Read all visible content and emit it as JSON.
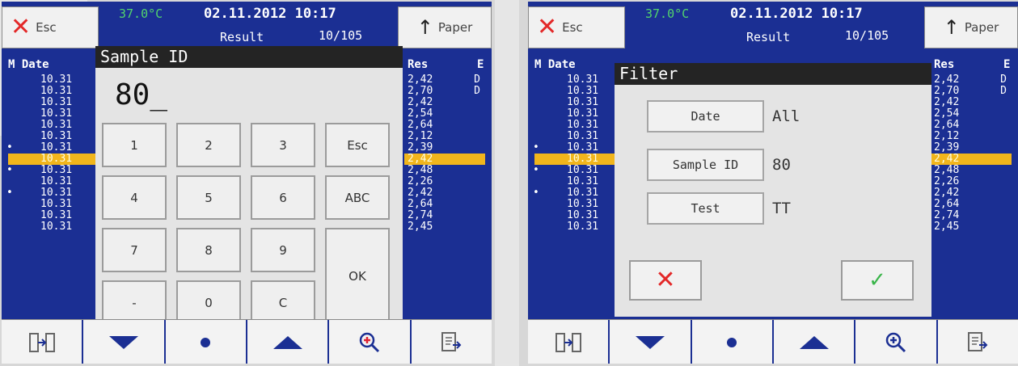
{
  "screens": [
    {
      "topbar": {
        "esc": "Esc",
        "temp": "37.0°C",
        "datetime": "02.11.2012  10:17",
        "view": "Result",
        "count": "10/105",
        "paper": "Paper"
      },
      "table": {
        "h_mdate": "M Date",
        "h_res": "Res",
        "h_e": "E",
        "rows": [
          {
            "dot": "",
            "d": "10.31",
            "sel": false
          },
          {
            "dot": "",
            "d": "10.31",
            "sel": false
          },
          {
            "dot": "",
            "d": "10.31",
            "sel": false
          },
          {
            "dot": "",
            "d": "10.31",
            "sel": false
          },
          {
            "dot": "",
            "d": "10.31",
            "sel": false
          },
          {
            "dot": "",
            "d": "10.31",
            "sel": false
          },
          {
            "dot": "•",
            "d": "10.31",
            "sel": false
          },
          {
            "dot": "",
            "d": "10.31",
            "sel": true
          },
          {
            "dot": "•",
            "d": "10.31",
            "sel": false
          },
          {
            "dot": "",
            "d": "10.31",
            "sel": false
          },
          {
            "dot": "•",
            "d": "10.31",
            "sel": false
          },
          {
            "dot": "",
            "d": "10.31",
            "sel": false
          },
          {
            "dot": "",
            "d": "10.31",
            "sel": false
          },
          {
            "dot": "",
            "d": "10.31",
            "sel": false
          }
        ],
        "res": [
          {
            "v": "2,42",
            "e": "D"
          },
          {
            "v": "2,70",
            "e": "D"
          },
          {
            "v": "2,42",
            "e": ""
          },
          {
            "v": "2,54",
            "e": ""
          },
          {
            "v": "2,64",
            "e": ""
          },
          {
            "v": "2,12",
            "e": ""
          },
          {
            "v": "2,39",
            "e": ""
          },
          {
            "v": "2,42",
            "e": ""
          },
          {
            "v": "2,48",
            "e": ""
          },
          {
            "v": "2,26",
            "e": ""
          },
          {
            "v": "2,42",
            "e": ""
          },
          {
            "v": "2,64",
            "e": ""
          },
          {
            "v": "2,74",
            "e": ""
          },
          {
            "v": "2,45",
            "e": ""
          }
        ]
      },
      "bottombar": [
        "split-view-icon",
        "arrow-down-icon",
        "dot-icon",
        "arrow-up-icon",
        "zoom-in-icon",
        "export-icon"
      ]
    },
    {
      "topbar": {
        "esc": "Esc",
        "temp": "37.0°C",
        "datetime": "02.11.2012  10:17",
        "view": "Result",
        "count": "10/105",
        "paper": "Paper"
      },
      "table": {
        "h_mdate": "M Date",
        "h_res": "Res",
        "h_e": "E",
        "rows": [
          {
            "dot": "",
            "d": "10.31",
            "sel": false
          },
          {
            "dot": "",
            "d": "10.31",
            "sel": false
          },
          {
            "dot": "",
            "d": "10.31",
            "sel": false
          },
          {
            "dot": "",
            "d": "10.31",
            "sel": false
          },
          {
            "dot": "",
            "d": "10.31",
            "sel": false
          },
          {
            "dot": "",
            "d": "10.31",
            "sel": false
          },
          {
            "dot": "•",
            "d": "10.31",
            "sel": false
          },
          {
            "dot": "",
            "d": "10.31",
            "sel": true
          },
          {
            "dot": "•",
            "d": "10.31",
            "sel": false
          },
          {
            "dot": "",
            "d": "10.31",
            "sel": false
          },
          {
            "dot": "•",
            "d": "10.31",
            "sel": false
          },
          {
            "dot": "",
            "d": "10.31",
            "sel": false
          },
          {
            "dot": "",
            "d": "10.31",
            "sel": false
          },
          {
            "dot": "",
            "d": "10.31",
            "sel": false
          }
        ],
        "res": [
          {
            "v": "2,42",
            "e": "D"
          },
          {
            "v": "2,70",
            "e": "D"
          },
          {
            "v": "2,42",
            "e": ""
          },
          {
            "v": "2,54",
            "e": ""
          },
          {
            "v": "2,64",
            "e": ""
          },
          {
            "v": "2,12",
            "e": ""
          },
          {
            "v": "2,39",
            "e": ""
          },
          {
            "v": "2,42",
            "e": ""
          },
          {
            "v": "2,48",
            "e": ""
          },
          {
            "v": "2,26",
            "e": ""
          },
          {
            "v": "2,42",
            "e": ""
          },
          {
            "v": "2,64",
            "e": ""
          },
          {
            "v": "2,74",
            "e": ""
          },
          {
            "v": "2,45",
            "e": ""
          }
        ]
      },
      "bottombar": [
        "split-view-icon",
        "arrow-down-icon",
        "dot-icon",
        "arrow-up-icon",
        "zoom-in-icon",
        "export-icon"
      ]
    }
  ],
  "keypad": {
    "title": "Sample ID",
    "entry": "80_",
    "keys": {
      "k1": "1",
      "k2": "2",
      "k3": "3",
      "esc": "Esc",
      "k4": "4",
      "k5": "5",
      "k6": "6",
      "abc": "ABC",
      "k7": "7",
      "k8": "8",
      "k9": "9",
      "ok": "OK",
      "minus": "-",
      "k0": "0",
      "c": "C"
    }
  },
  "filter": {
    "title": "Filter",
    "rows": [
      {
        "label": "Date",
        "value": "All"
      },
      {
        "label": "Sample ID",
        "value": "80"
      },
      {
        "label": "Test",
        "value": "TT"
      }
    ]
  },
  "colors": {
    "screen_bg": "#1b2f93",
    "highlight": "#f1b51c",
    "cancel": "#e32828",
    "confirm": "#3ab54a",
    "temp": "#52d46c"
  }
}
